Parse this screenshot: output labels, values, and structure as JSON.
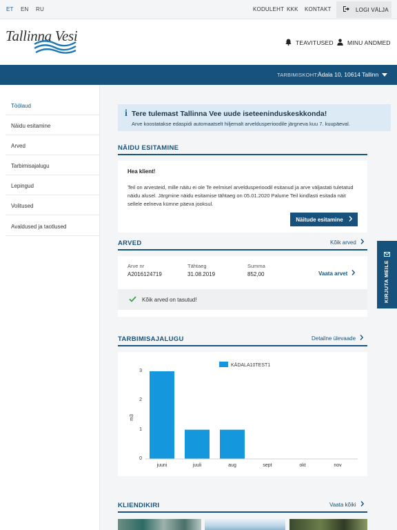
{
  "languages": [
    {
      "code": "ET",
      "active": true
    },
    {
      "code": "EN",
      "active": false
    },
    {
      "code": "RU",
      "active": false
    }
  ],
  "toplinks": [
    "KODULEHT",
    "KKK",
    "KONTAKT"
  ],
  "logout_label": "LOGI VÄLJA",
  "logo_text": "Tallinna Vesi",
  "header": {
    "notices_label": "TEAVITUSED",
    "my_data_label": "MINU ANDMED"
  },
  "location": {
    "label": "TARBIMISKOHT:",
    "value": "Ädala 10, 10614 Tallinn"
  },
  "sidebar": {
    "items": [
      {
        "label": "Töölaud",
        "active": true
      },
      {
        "label": "Näidu esitamine",
        "active": false
      },
      {
        "label": "Arved",
        "active": false
      },
      {
        "label": "Tarbimisajalugu",
        "active": false
      },
      {
        "label": "Lepingud",
        "active": false
      },
      {
        "label": "Volitused",
        "active": false
      },
      {
        "label": "Avaldused ja taotlused",
        "active": false
      }
    ]
  },
  "welcome": {
    "title": "Tere tulemast Tallinna Vee uude iseteeninduskeskkonda!",
    "subtitle": "Arve koostatakse edaspidi automaatselt hiljemalt arveldusperioodile järgneva kuu 7. kuupäeval."
  },
  "meter_reading": {
    "title": "NÄIDU ESITAMINE",
    "greeting": "Hea klient!",
    "body": "Teil on arvesteid, mille näitu ei ole Te eelmisel arveldusperioodil esitanud ja arve väljastati tuletatud näidu alusel. Järgmine näidu esitamise tähtaeg on 05.01.2020 Palume Teil kindlasti esitada näit sellele eelneva kümne päeva jooksul.",
    "button_label": "Näitude esitamine"
  },
  "bills": {
    "title": "ARVED",
    "all_link": "Kõik arved",
    "columns": [
      "Arve nr",
      "Tähtaeg",
      "Summa"
    ],
    "row": {
      "number": "A2016124719",
      "due": "31.08.2019",
      "amount": "852,00"
    },
    "view_link": "Vaata arvet",
    "paid_message": "Kõik arved on tasutud!"
  },
  "consumption": {
    "title": "TARBIMISAJALUGU",
    "detail_link": "Detailne ülevaade"
  },
  "chart_data": {
    "type": "bar",
    "categories": [
      "juuni",
      "juuli",
      "aug",
      "sept",
      "okt",
      "nov"
    ],
    "series": [
      {
        "name": "KÄDALA10TEST1",
        "values": [
          3,
          1,
          1,
          0,
          0,
          0
        ],
        "color": "#1497dc"
      }
    ],
    "ylabel": "m3",
    "ylim": [
      0,
      3
    ],
    "yticks": [
      "0",
      "1",
      "2",
      "3"
    ],
    "grid": false,
    "legend": "top"
  },
  "client_letter": {
    "title": "KLIENDIKIRI",
    "all_link": "Vaata kõiki"
  },
  "feedback_label": "KIRJUTA MEILE",
  "colors": {
    "primary": "#17527c",
    "accent_bar": "#1497dc",
    "info_bg": "#dbeaf4",
    "success": "#3aa14f"
  }
}
